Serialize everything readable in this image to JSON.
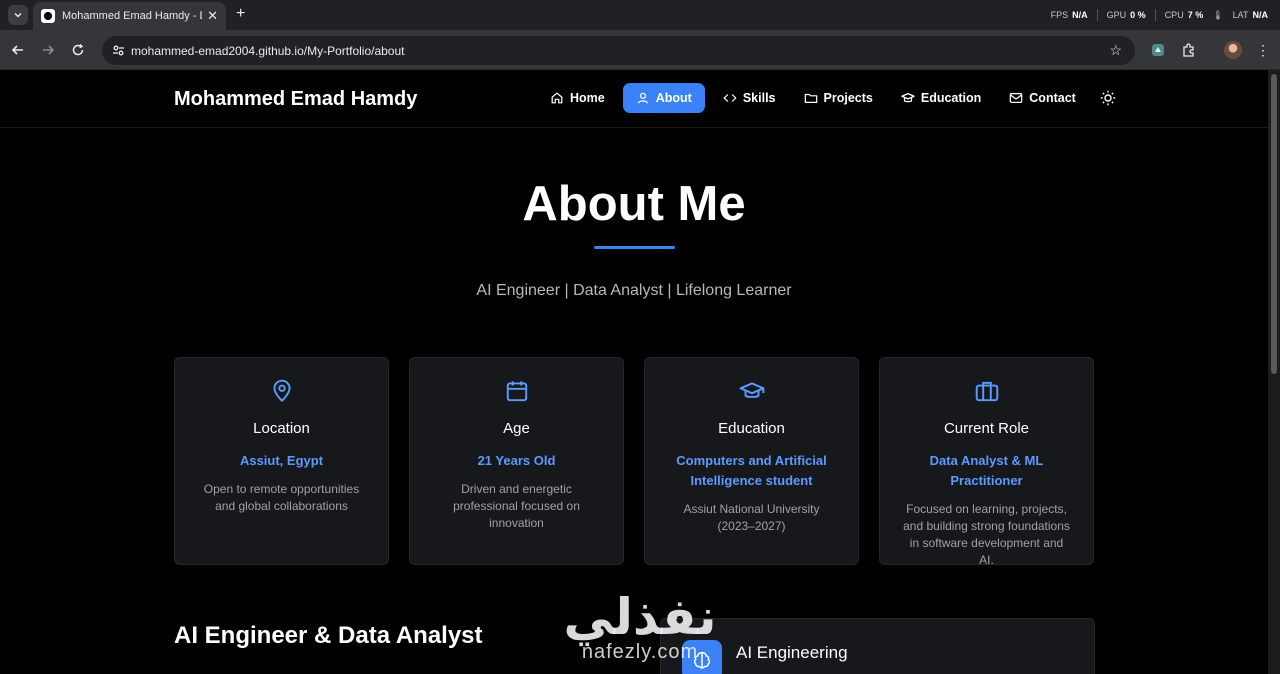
{
  "browser": {
    "tab_title": "Mohammed Emad Hamdy - Da",
    "url": "mohammed-emad2004.github.io/My-Portfolio/about",
    "stats": {
      "fps_label": "FPS",
      "fps_value": "N/A",
      "gpu_label": "GPU",
      "gpu_value": "0 %",
      "cpu_label": "CPU",
      "cpu_value": "7 %",
      "lat_label": "LAT",
      "lat_value": "N/A"
    }
  },
  "site": {
    "brand": "Mohammed Emad Hamdy",
    "nav": [
      {
        "label": "Home",
        "icon": "home-icon"
      },
      {
        "label": "About",
        "icon": "user-icon",
        "active": true
      },
      {
        "label": "Skills",
        "icon": "code-icon"
      },
      {
        "label": "Projects",
        "icon": "folder-icon"
      },
      {
        "label": "Education",
        "icon": "graduation-cap-icon"
      },
      {
        "label": "Contact",
        "icon": "mail-icon"
      }
    ],
    "theme_toggle_icon": "sun-icon",
    "accent_color": "#3b82f6"
  },
  "hero": {
    "title": "About Me",
    "subtitle": "AI Engineer | Data Analyst | Lifelong Learner"
  },
  "cards": [
    {
      "icon": "map-pin-icon",
      "title": "Location",
      "highlight": "Assiut, Egypt",
      "description": "Open to remote opportunities and global collaborations"
    },
    {
      "icon": "calendar-icon",
      "title": "Age",
      "highlight": "21 Years Old",
      "description": "Driven and energetic professional focused on innovation"
    },
    {
      "icon": "graduation-cap-icon",
      "title": "Education",
      "highlight": "Computers and Artificial Intelligence student",
      "description": "Assiut National University (2023–2027)"
    },
    {
      "icon": "briefcase-icon",
      "title": "Current Role",
      "highlight": "Data Analyst & ML Practitioner",
      "description": "Focused on learning, projects, and building strong foundations in software development and AI."
    }
  ],
  "section": {
    "title": "AI Engineer & Data Analyst"
  },
  "skill_card": {
    "icon": "brain-icon",
    "title": "AI Engineering"
  },
  "watermark": {
    "arabic": "نفذلي",
    "latin": "nafezly.com"
  }
}
